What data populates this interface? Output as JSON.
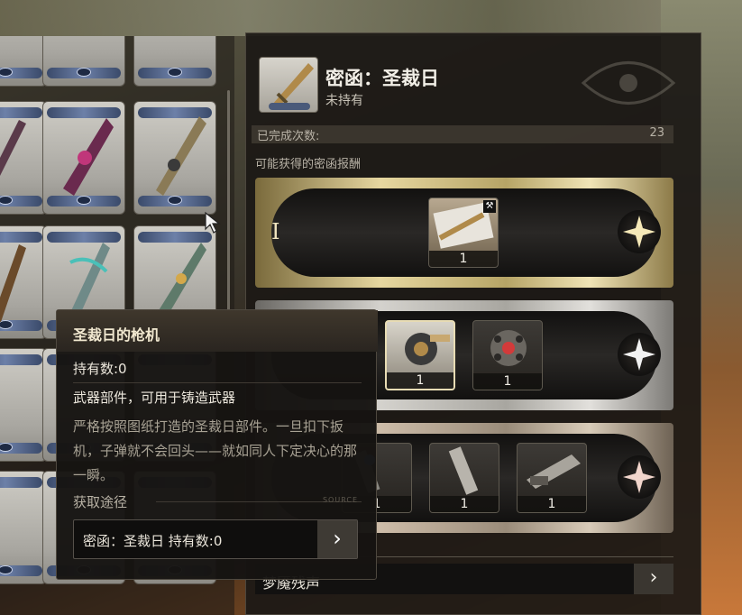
{
  "header": {
    "title": "密函：圣裁日",
    "subtitle": "未持有"
  },
  "completion": {
    "label": "已完成次数:",
    "value": "23"
  },
  "rewards": {
    "section_label": "可能获得的密函报酬",
    "tiers": [
      {
        "numeral": "I",
        "items": [
          {
            "name": "weapon-blueprint",
            "qty": "1",
            "tag": "hammer-icon"
          }
        ]
      },
      {
        "numeral": "",
        "items": [
          {
            "name": "trigger-part",
            "qty": "1"
          },
          {
            "name": "orb-part",
            "qty": "1"
          }
        ]
      },
      {
        "numeral": "",
        "items": [
          {
            "name": "barrel-part",
            "qty": "1"
          },
          {
            "name": "cylinder-part",
            "qty": "1"
          },
          {
            "name": "blade-part",
            "qty": "1"
          }
        ]
      }
    ]
  },
  "bottom": {
    "label": "梦魇残声",
    "arrow": "›"
  },
  "tooltip": {
    "title": "圣裁日的枪机",
    "owned": "持有数:0",
    "type": "武器部件，可用于铸造武器",
    "description": "严格按照图纸打造的圣裁日部件。一旦扣下扳机，子弹就不会回头——就如同人下定决心的那一瞬。",
    "source_label": "获取途径",
    "source_tag": "SOURCE",
    "link_label": "密函：圣裁日 持有数:0",
    "link_arrow": "›"
  },
  "colors": {
    "gold_tier": "#e6d7a0",
    "silver_tier": "#d4d2cd",
    "bronze_tier": "#cdbca8",
    "panel_bg": "#1c1916"
  }
}
